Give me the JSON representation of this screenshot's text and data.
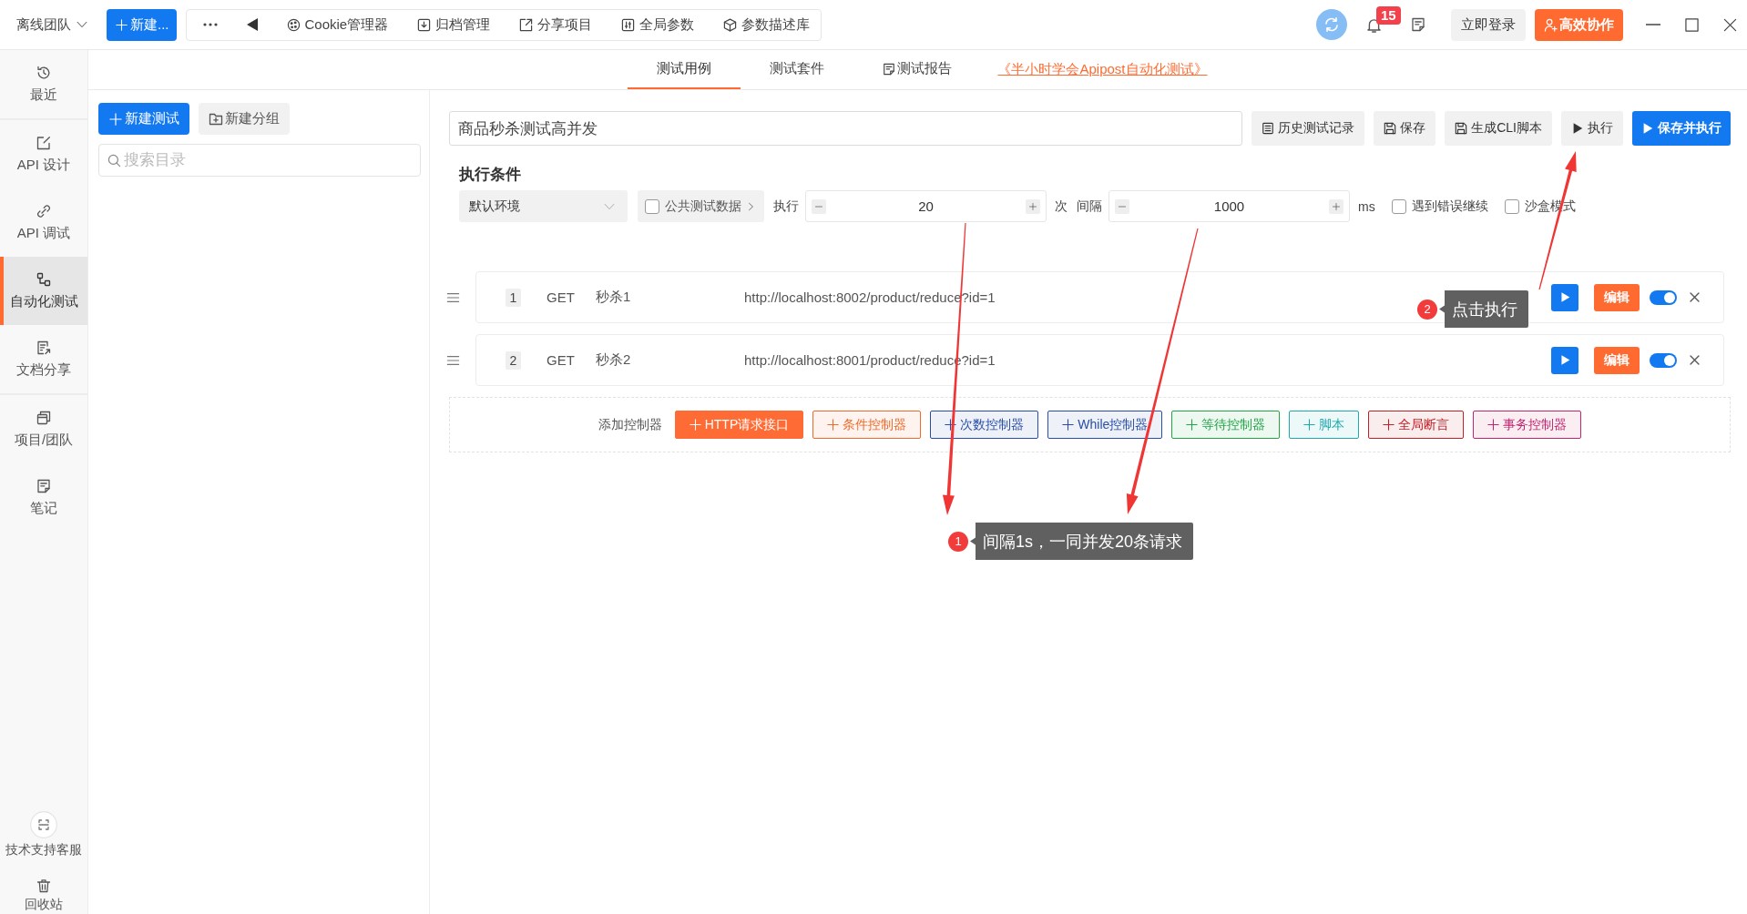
{
  "top_bar": {
    "team": "离线团队",
    "new_button": "新建...",
    "toolbar": [
      "Cookie管理器",
      "归档管理",
      "分享项目",
      "全局参数",
      "参数描述库"
    ],
    "notification_count": "15",
    "login_button": "立即登录",
    "collab_button": "高效协作"
  },
  "sidebar": {
    "groups": [
      {
        "items": [
          {
            "label": "最近",
            "selected": false
          }
        ]
      },
      {
        "items": [
          {
            "label": "API 设计",
            "selected": false
          },
          {
            "label": "API 调试",
            "selected": false
          },
          {
            "label": "自动化测试",
            "selected": true
          },
          {
            "label": "文档分享",
            "selected": false
          }
        ]
      },
      {
        "items": [
          {
            "label": "项目/团队",
            "selected": false
          },
          {
            "label": "笔记",
            "selected": false
          }
        ]
      }
    ],
    "bottom_items": [
      "技术支持客服",
      "回收站"
    ]
  },
  "tabs": [
    {
      "label": "测试用例",
      "selected": true
    },
    {
      "label": "测试套件",
      "selected": false
    },
    {
      "label": "测试报告",
      "selected": false
    }
  ],
  "tutorial_link": "《半小时学会Apipost自动化测试》",
  "tree_panel": {
    "new_test_button": "新建测试",
    "new_group_button": "新建分组",
    "search": {
      "placeholder": "搜索目录"
    }
  },
  "test_case": {
    "name": "商品秒杀测试高并发",
    "actions": [
      {
        "label": "历史测试记录",
        "kind": "history"
      },
      {
        "label": "保存",
        "kind": "save"
      },
      {
        "label": "生成CLI脚本",
        "kind": "cli"
      },
      {
        "label": "执行",
        "kind": "run"
      },
      {
        "label": "保存并执行",
        "kind": "save_run"
      }
    ]
  },
  "conditions": {
    "title": "执行条件",
    "environment": "默认环境",
    "public_data": {
      "label": "公共测试数据",
      "checked": false
    },
    "loop": {
      "label": "执行",
      "value": "20",
      "unit": "次"
    },
    "interval": {
      "label": "间隔",
      "value": "1000",
      "unit": "ms"
    },
    "options": [
      {
        "label": "遇到错误继续",
        "checked": false
      },
      {
        "label": "沙盒模式",
        "checked": false
      }
    ]
  },
  "steps": [
    {
      "index": "1",
      "method": "GET",
      "name": "秒杀1",
      "url": "http://localhost:8002/product/reduce?id=1",
      "edit_button": "编辑",
      "on": true
    },
    {
      "index": "2",
      "method": "GET",
      "name": "秒杀2",
      "url": "http://localhost:8001/product/reduce?id=1",
      "edit_button": "编辑",
      "on": true
    }
  ],
  "controllers": {
    "label": "添加控制器",
    "items": [
      {
        "label": "HTTP请求接口",
        "kind": "filled",
        "color": "#ff6b35"
      },
      {
        "label": "条件控制器",
        "kind": "outline",
        "color": "#ee6a2a"
      },
      {
        "label": "次数控制器",
        "kind": "outline",
        "color": "#2a4ea8"
      },
      {
        "label": "While控制器",
        "kind": "outline",
        "color": "#2a4ea8"
      },
      {
        "label": "等待控制器",
        "kind": "outline",
        "color": "#22a447"
      },
      {
        "label": "脚本",
        "kind": "outline",
        "color": "#1fa9ae"
      },
      {
        "label": "全局断言",
        "kind": "outline",
        "color": "#c21f26"
      },
      {
        "label": "事务控制器",
        "kind": "outline",
        "color": "#c0266e"
      }
    ]
  },
  "annotations": [
    {
      "number": "1",
      "text": "间隔1s，一同并发20条请求"
    },
    {
      "number": "2",
      "text": "点击执行"
    }
  ]
}
